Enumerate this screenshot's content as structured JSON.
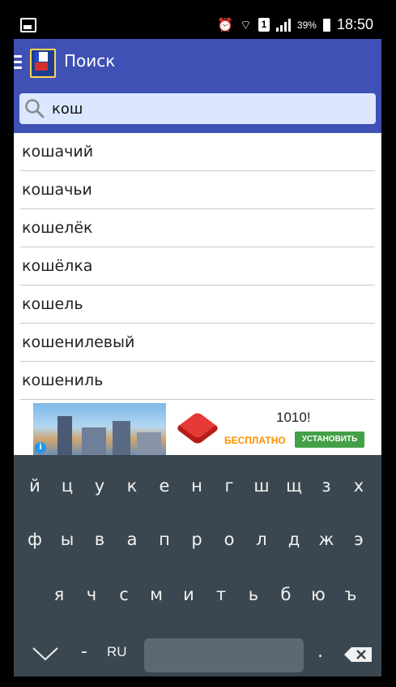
{
  "status_bar": {
    "battery": "39%",
    "time": "18:50",
    "sim": "1"
  },
  "app_bar": {
    "title": "Поиск"
  },
  "search": {
    "value": "кош"
  },
  "results": [
    "кошачий",
    "кошачьи",
    "кошелёк",
    "кошёлка",
    "кошель",
    "кошенилевый",
    "кошениль"
  ],
  "ad": {
    "app_name": "1010!",
    "free_label": "БЕСПЛАТНО",
    "install_label": "УСТАНОВИТЬ",
    "info": "i"
  },
  "keyboard": {
    "row1": [
      "й",
      "ц",
      "у",
      "к",
      "е",
      "н",
      "г",
      "ш",
      "щ",
      "з",
      "х"
    ],
    "row2": [
      "ф",
      "ы",
      "в",
      "а",
      "п",
      "р",
      "о",
      "л",
      "д",
      "ж",
      "э"
    ],
    "row3": [
      "я",
      "ч",
      "с",
      "м",
      "и",
      "т",
      "ь",
      "б",
      "ю",
      "ъ"
    ],
    "dash": "-",
    "lang": "RU",
    "period": "."
  }
}
